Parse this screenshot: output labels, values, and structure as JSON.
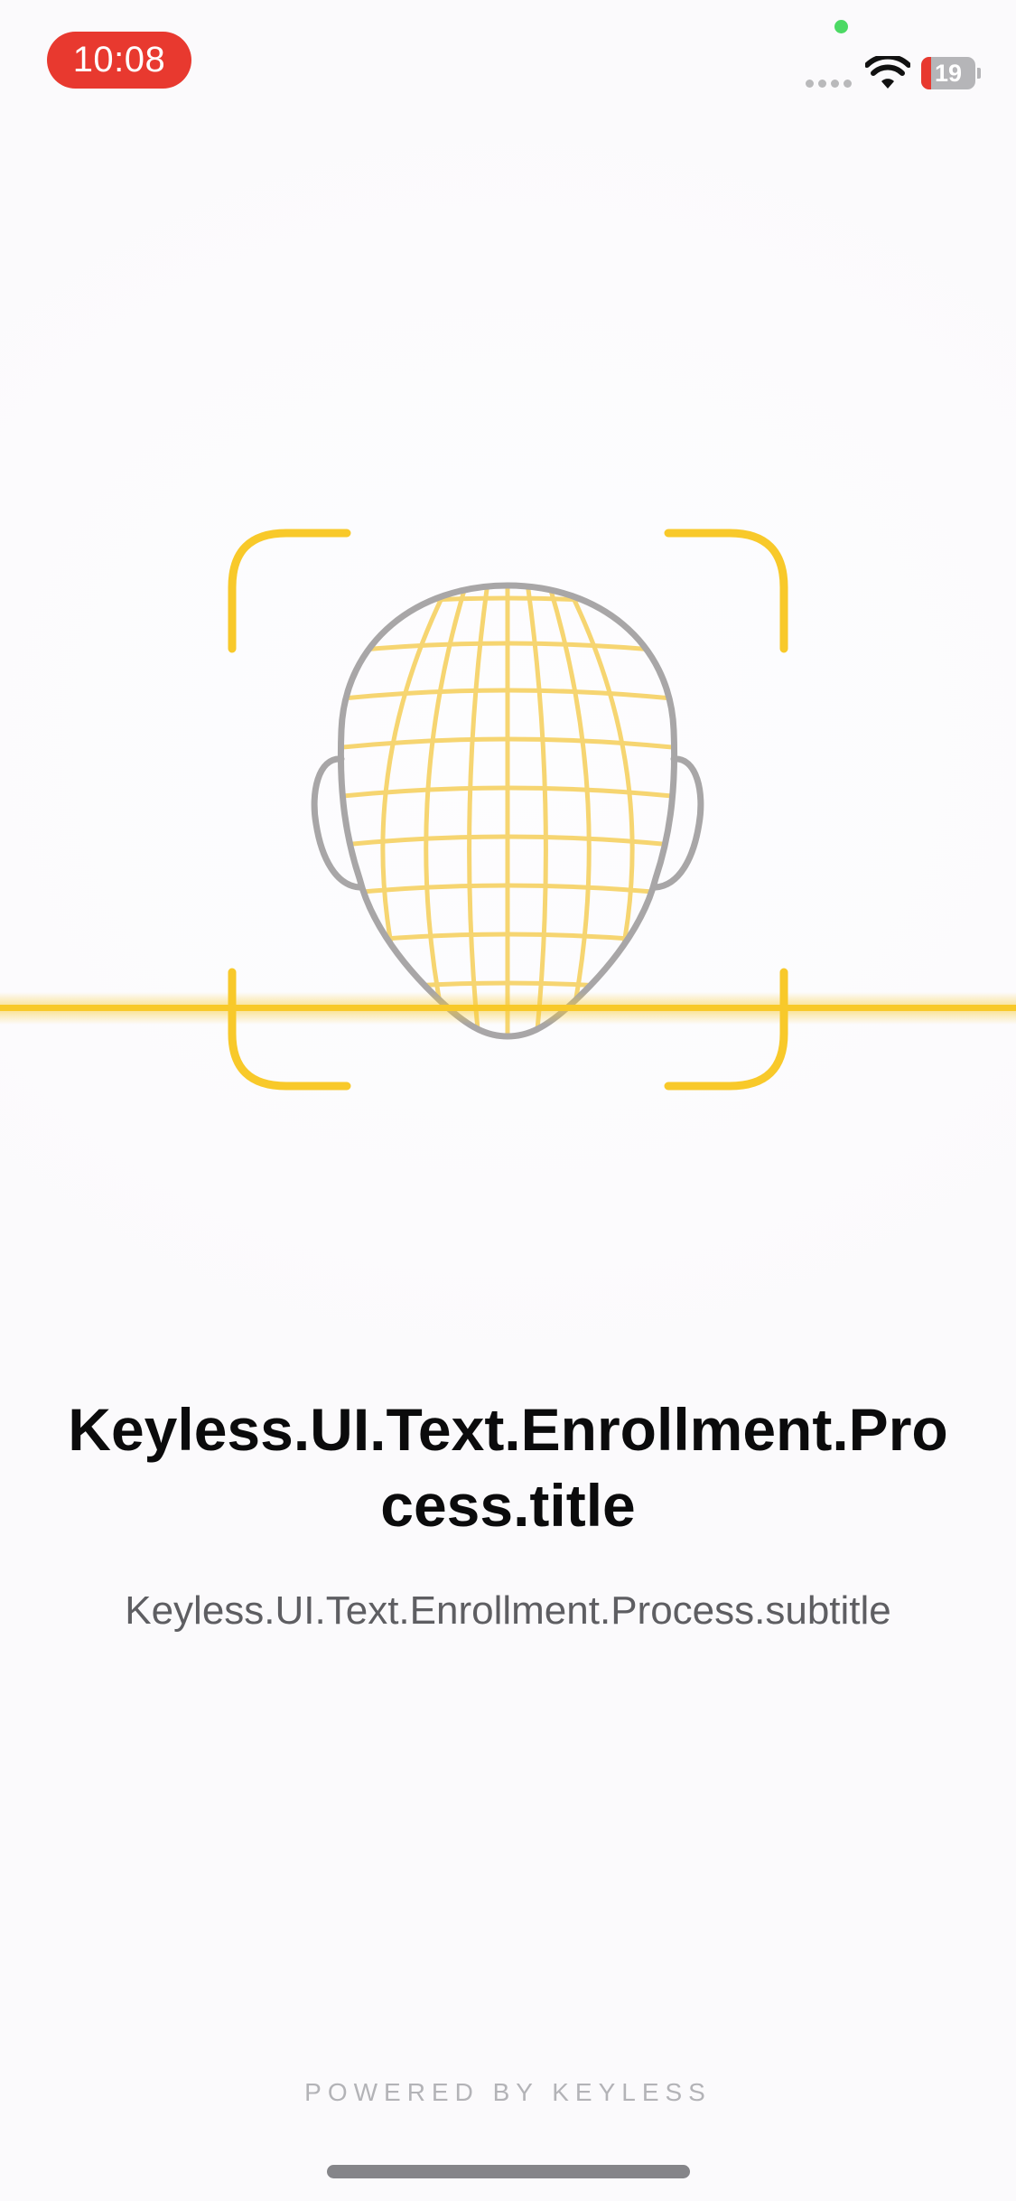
{
  "status_bar": {
    "time": "10:08",
    "battery_level": "19",
    "battery_fraction": 0.19,
    "colors": {
      "time_pill": "#e8392f",
      "privacy_dot": "#4cd964",
      "battery_low": "#e8392f"
    },
    "icons": [
      "cellular-signal-icon",
      "wifi-icon",
      "battery-icon",
      "privacy-indicator-icon"
    ]
  },
  "illustration": {
    "icon": "face-scan-icon",
    "colors": {
      "accent": "#f8c92a",
      "outline": "#a8a6a7",
      "mesh": "#f6d571"
    }
  },
  "content": {
    "title": "Keyless.UI.Text.Enrollment.Process.title",
    "subtitle": "Keyless.UI.Text.Enrollment.Process.subtitle"
  },
  "footer": {
    "powered_by": "POWERED BY KEYLESS"
  }
}
